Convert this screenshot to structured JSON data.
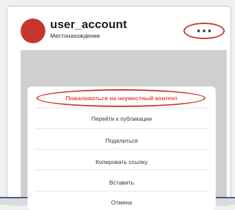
{
  "post": {
    "username": "user_account",
    "location": "Местонахождение"
  },
  "icons": {
    "avatar": "avatar-circle",
    "more": "more-horizontal-icon"
  },
  "colors": {
    "accent_red": "#c8352f",
    "report_text": "#e5484d",
    "media_bg": "#cfcfcf"
  },
  "menu": {
    "items": [
      {
        "label": "Пожаловаться на неуместный контент"
      },
      {
        "label": "Перейти к публикации"
      },
      {
        "label": "Поделиться"
      },
      {
        "label": "Копировать ссылку"
      },
      {
        "label": "Вставить"
      },
      {
        "label": "Отмена"
      }
    ]
  }
}
